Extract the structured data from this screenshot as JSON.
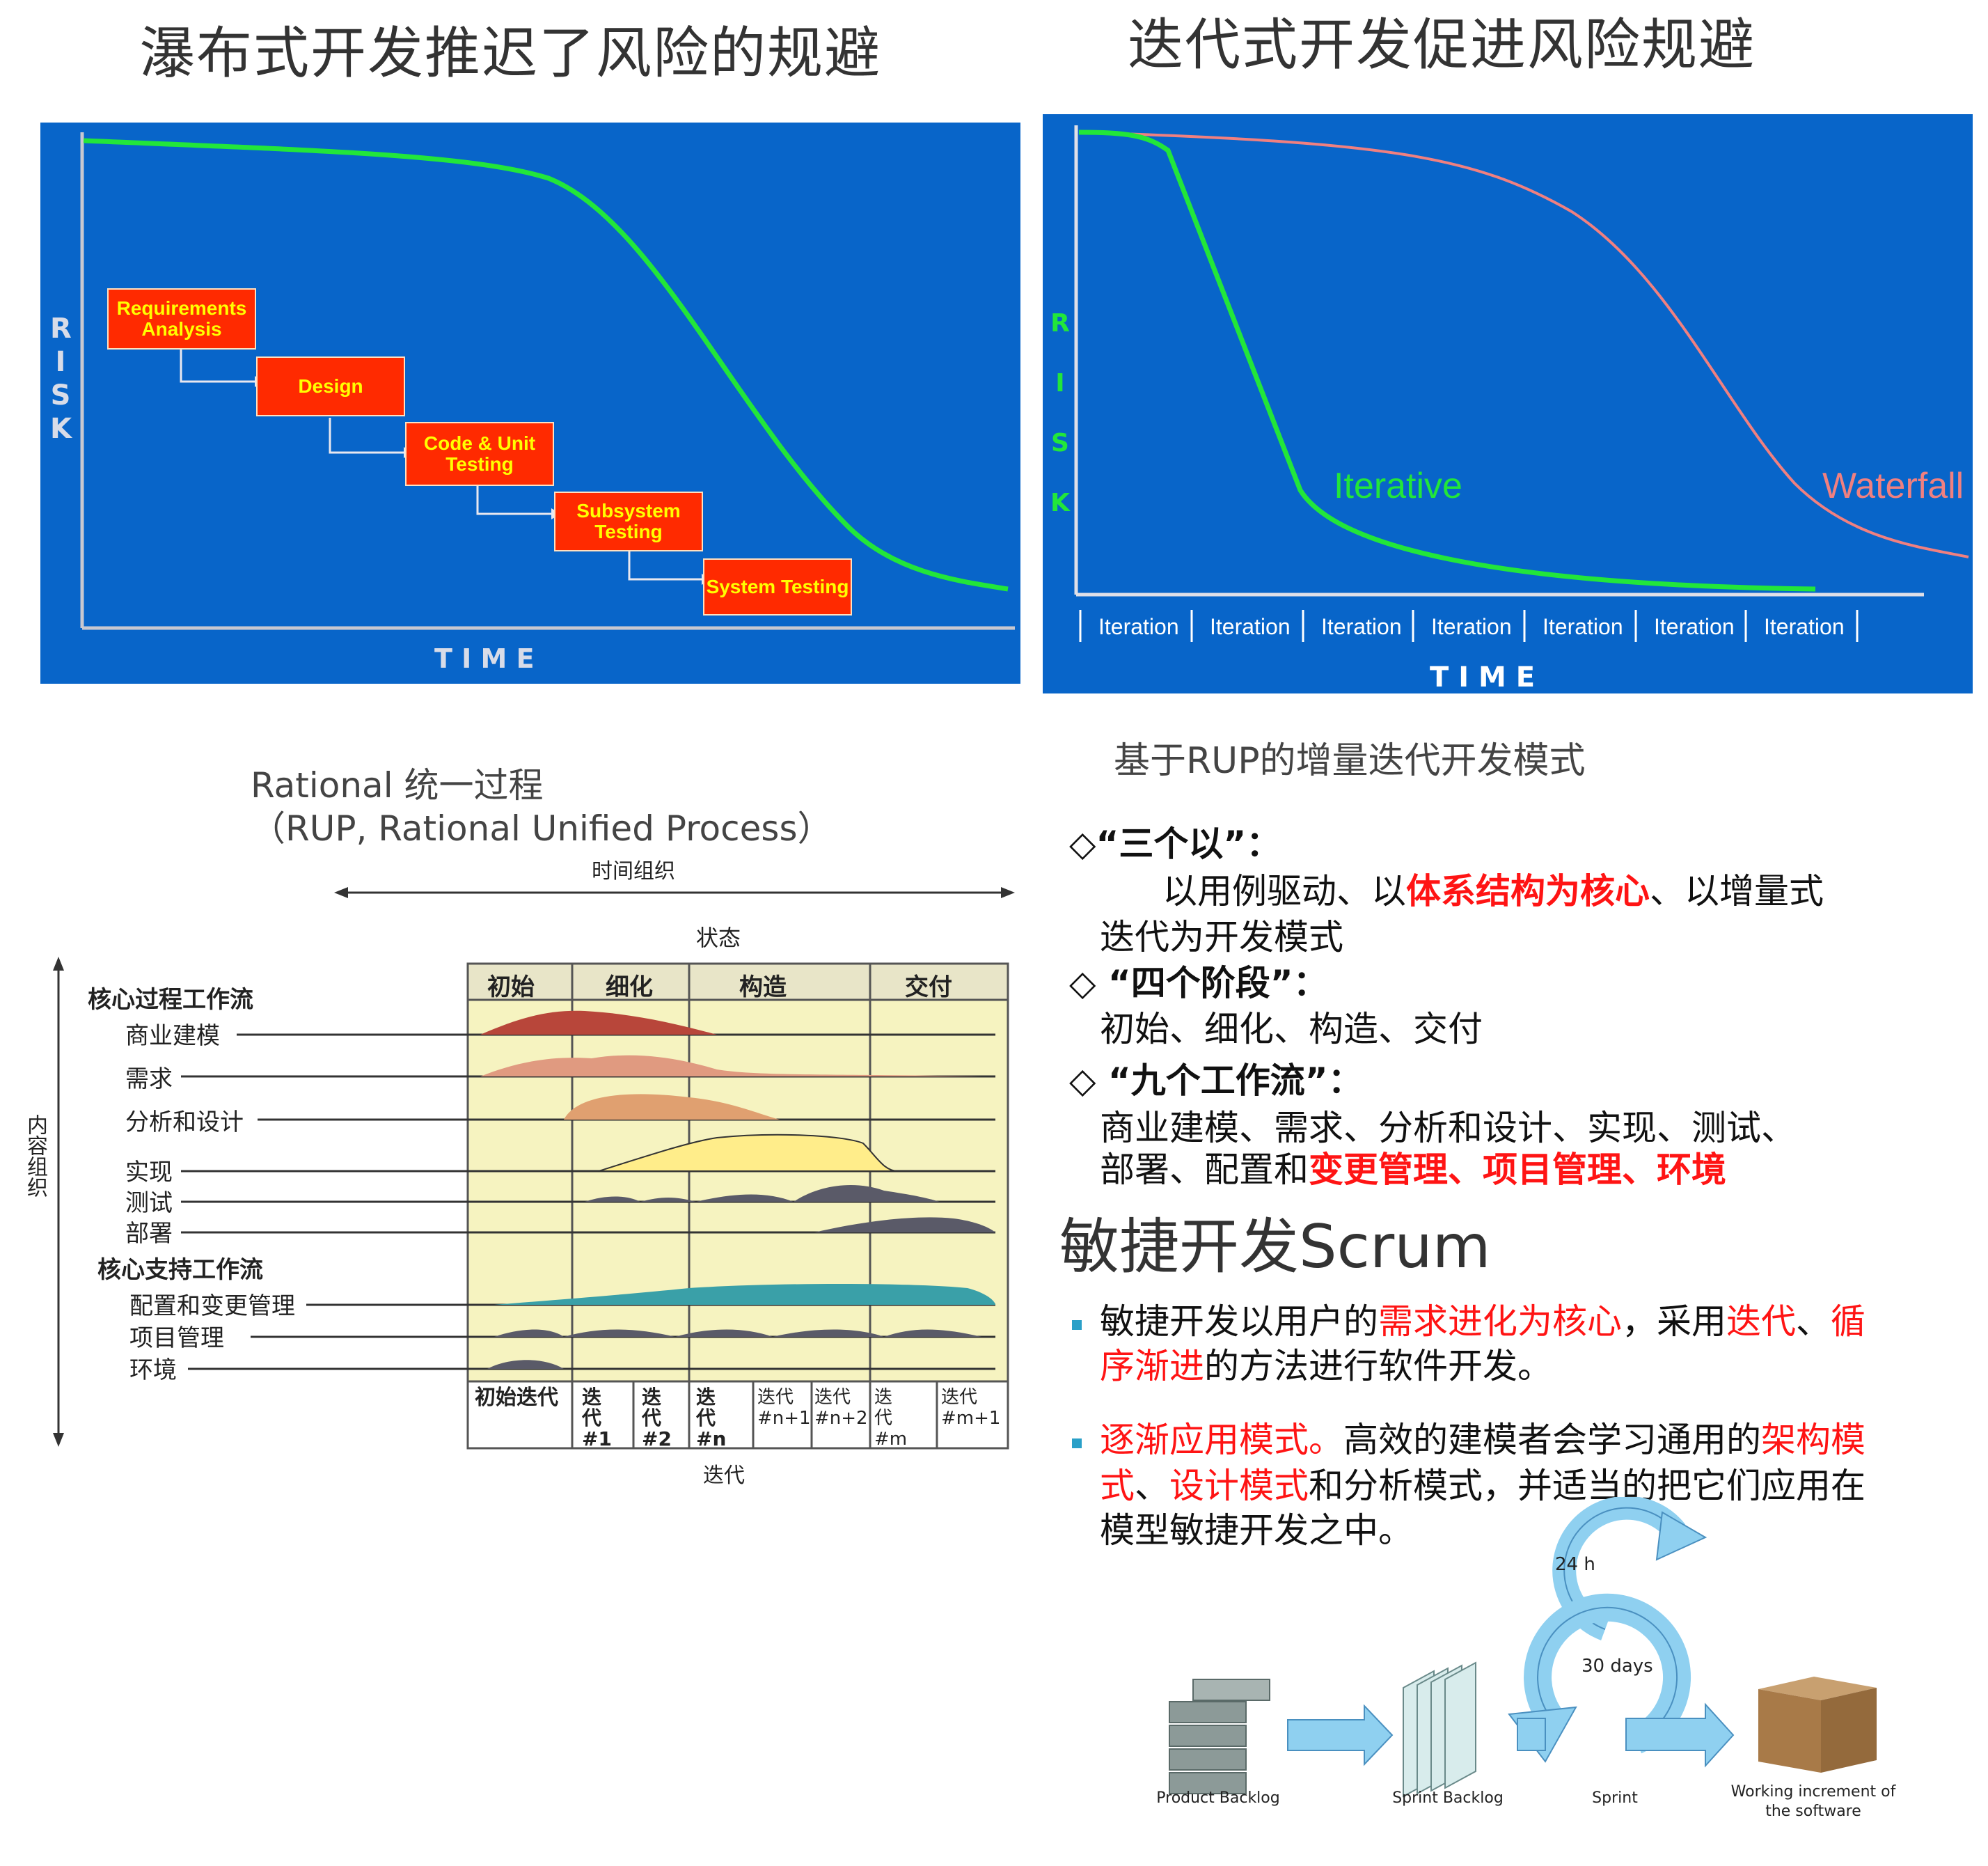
{
  "titles": {
    "waterfall": "瀑布式开发推迟了风险的规避",
    "iterative": "迭代式开发促进风险规避"
  },
  "waterfall_chart": {
    "ylabel": [
      "R",
      "I",
      "S",
      "K"
    ],
    "xlabel": "T I M E",
    "stages": [
      "Requirements Analysis",
      "Design",
      "Code & Unit Testing",
      "Subsystem Testing",
      "System Testing"
    ]
  },
  "iterative_chart": {
    "ylabel": [
      "R",
      "I",
      "S",
      "K"
    ],
    "xlabel": "T I M E",
    "series": [
      {
        "name": "Iterative",
        "color": "#22e63a"
      },
      {
        "name": "Waterfall",
        "color": "#f08080"
      }
    ],
    "iterations": [
      "Iteration",
      "Iteration",
      "Iteration",
      "Iteration",
      "Iteration",
      "Iteration",
      "Iteration"
    ]
  },
  "rup": {
    "title_line1": "Rational 统一过程",
    "title_line2": "（RUP, Rational Unified Process）",
    "time_axis": "时间组织",
    "content_axis": "内容组织",
    "phase_header": "状态",
    "phases": [
      "初始",
      "细化",
      "构造",
      "交付"
    ],
    "core_process_header": "核心过程工作流",
    "core_support_header": "核心支持工作流",
    "workflows": [
      "商业建模",
      "需求",
      "分析和设计",
      "实现",
      "测试",
      "部署"
    ],
    "support": [
      "配置和变更管理",
      "项目管理",
      "环境"
    ],
    "iterations": [
      "初始迭代",
      "迭代#1",
      "迭代#2",
      "迭代#n",
      "迭代#n+1",
      "迭代#n+2",
      "迭代#m",
      "迭代#m+1"
    ],
    "iter_axis": "迭代"
  },
  "rup_text": {
    "heading": "基于RUP的增量迭代开发模式",
    "b1_title": "◇“三个以”：",
    "b1_line1_a": "以用例驱动、以",
    "b1_line1_red": "体系结构为核心",
    "b1_line1_b": "、以增量式",
    "b1_line2": "迭代为开发模式",
    "b2_title": "◇ “四个阶段”：",
    "b2_line": "初始、细化、构造、交付",
    "b3_title": "◇ “九个工作流”：",
    "b3_line1": "商业建模、需求、分析和设计、实现、测试、",
    "b3_line2_a": "部署、配置和",
    "b3_line2_red": "变更管理、项目管理、环境"
  },
  "scrum": {
    "heading": "敏捷开发Scrum",
    "p1_a": "敏捷开发以用户的",
    "p1_red1": "需求进化为核心",
    "p1_b": "，采用",
    "p1_red2": "迭代",
    "p1_c": "、",
    "p1_red3": "循",
    "p1_red4": "序渐进",
    "p1_d": "的方法进行软件开发。",
    "p2_red1": "逐渐应用模式。",
    "p2_a": "高效的建模者会学习通用的",
    "p2_red2": "架构模",
    "p2_red3": "式",
    "p2_b": "、",
    "p2_red4": "设计模式",
    "p2_c": "和分析模式，并适当的把它们应用在",
    "p2_line3": "模型敏捷开发之中。",
    "cycle_day": "24 h",
    "cycle_sprint": "30 days",
    "labels": [
      "Product Backlog",
      "Sprint Backlog",
      "Sprint",
      "Working increment of the software"
    ]
  }
}
